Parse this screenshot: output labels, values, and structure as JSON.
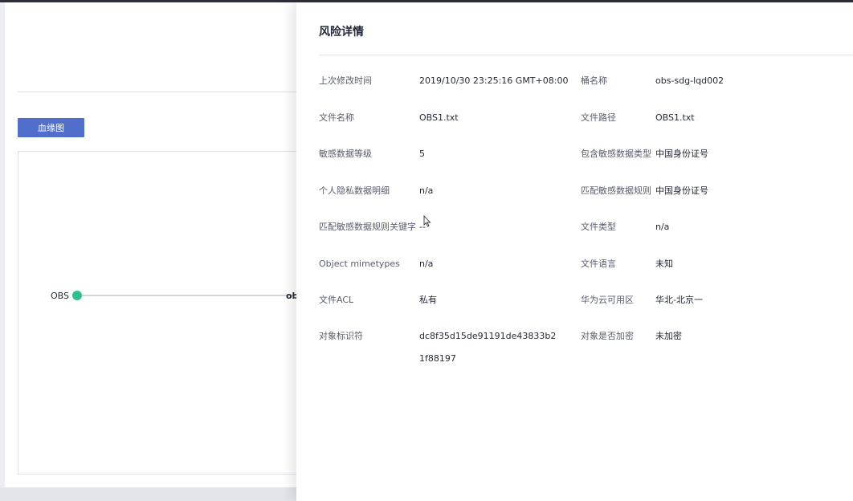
{
  "background": {
    "lineage_button": "血缘图",
    "graph": {
      "source_node_label": "OBS",
      "target_node_label": "ob",
      "node_color": "#2ec08f"
    }
  },
  "drawer": {
    "title": "风险详情",
    "left_fields": [
      {
        "label": "上次修改时间",
        "value": "2019/10/30 23:25:16 GMT+08:00"
      },
      {
        "label": "文件名称",
        "value": "OBS1.txt"
      },
      {
        "label": "敏感数据等级",
        "value": "5"
      },
      {
        "label": "个人隐私数据明细",
        "value": "n/a"
      },
      {
        "label": "匹配敏感数据规则关键字",
        "value": "--"
      },
      {
        "label": "Object mimetypes",
        "value": "n/a"
      },
      {
        "label": "文件ACL",
        "value": "私有"
      },
      {
        "label": "对象标识符",
        "value": "dc8f35d15de91191de43833b21f88197"
      }
    ],
    "right_fields": [
      {
        "label": "桶名称",
        "value": "obs-sdg-lqd002"
      },
      {
        "label": "文件路径",
        "value": "OBS1.txt"
      },
      {
        "label": "包含敏感数据类型",
        "value": "中国身份证号"
      },
      {
        "label": "匹配敏感数据规则",
        "value": "中国身份证号"
      },
      {
        "label": "文件类型",
        "value": "n/a"
      },
      {
        "label": "文件语言",
        "value": "未知"
      },
      {
        "label": "华为云可用区",
        "value": "华北-北京一"
      },
      {
        "label": "对象是否加密",
        "value": "未加密"
      }
    ]
  },
  "colors": {
    "primary_button": "#526ecc",
    "node": "#2ec08f"
  }
}
